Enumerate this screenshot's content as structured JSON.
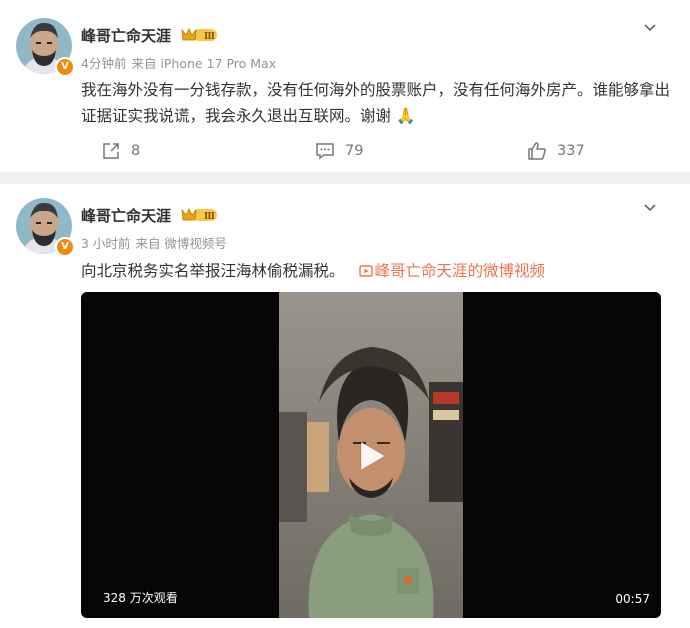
{
  "post1": {
    "author": "峰哥亡命天涯",
    "level": "Ⅲ",
    "verified": "V",
    "time": "4分钟前",
    "source": "来自 iPhone 17 Pro Max",
    "text": "我在海外没有一分钱存款，没有任何海外的股票账户，没有任何海外房产。谁能够拿出证据证实我说谎，我会永久退出互联网。谢谢",
    "emoji": "🙏",
    "reposts": "8",
    "comments": "79",
    "likes": "337"
  },
  "post2": {
    "author": "峰哥亡命天涯",
    "level": "Ⅲ",
    "verified": "V",
    "time": "3 小时前",
    "source": "来自 微博视频号",
    "text": "向北京税务实名举报汪海林偷税漏税。",
    "video_link": "峰哥亡命天涯的微博视频",
    "video": {
      "views": "328 万次观看",
      "duration": "00:57"
    }
  },
  "colors": {
    "accent": "#eb7350",
    "badge": "#f08a0d",
    "meta": "#939393"
  }
}
